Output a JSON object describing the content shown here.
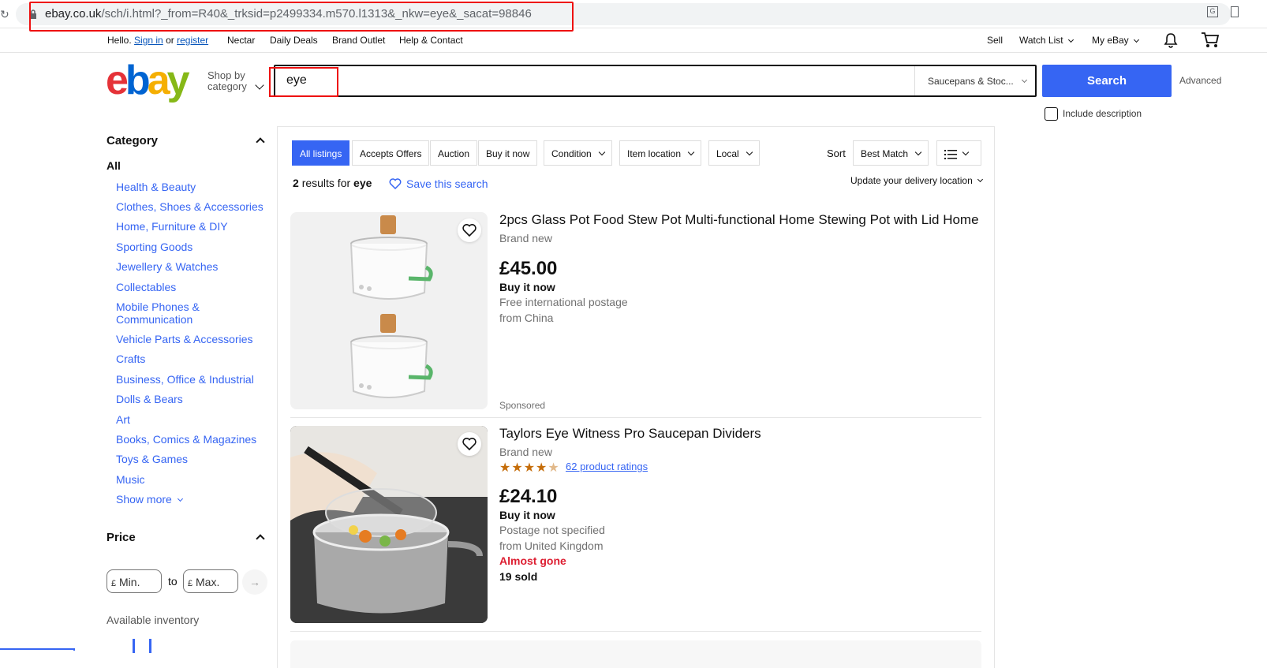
{
  "browser": {
    "url_domain": "ebay.co.uk",
    "url_path": "/sch/i.html?_from=R40&_trksid=p2499334.m570.l1313&_nkw=eye&_sacat=98846"
  },
  "topnav": {
    "hello": "Hello.",
    "sign_in": "Sign in",
    "or": "or",
    "register": "register",
    "links": [
      "Nectar",
      "Daily Deals",
      "Brand Outlet",
      "Help & Contact"
    ],
    "sell": "Sell",
    "watch_list": "Watch List",
    "my_ebay": "My eBay"
  },
  "header": {
    "logo_letters": [
      "e",
      "b",
      "a",
      "y"
    ],
    "shop_by_line1": "Shop by",
    "shop_by_line2": "category",
    "search_value": "eye",
    "category_select": "Saucepans & Stoc...",
    "search_button": "Search",
    "advanced": "Advanced",
    "include_description": "Include description"
  },
  "sidebar": {
    "category_heading": "Category",
    "all": "All",
    "categories": [
      "Health & Beauty",
      "Clothes, Shoes & Accessories",
      "Home, Furniture & DIY",
      "Sporting Goods",
      "Jewellery & Watches",
      "Collectables",
      "Mobile Phones &",
      "Communication",
      "Vehicle Parts & Accessories",
      "Crafts",
      "Business, Office & Industrial",
      "Dolls & Bears",
      "Art",
      "Books, Comics & Magazines",
      "Toys & Games",
      "Music"
    ],
    "show_more": "Show more",
    "price_heading": "Price",
    "currency": "£",
    "min_placeholder": "Min.",
    "to": "to",
    "max_placeholder": "Max.",
    "available_inventory": "Available inventory"
  },
  "results": {
    "chips": [
      "All listings",
      "Accepts Offers",
      "Auction",
      "Buy it now",
      "Condition",
      "Item location",
      "Local"
    ],
    "sort_label": "Sort",
    "sort_value": "Best Match",
    "count": "2",
    "results_for": "results for",
    "query": "eye",
    "save_search": "Save this search",
    "update_location": "Update your delivery location",
    "items": [
      {
        "title": "2pcs Glass Pot Food Stew Pot Multi-functional Home Stewing Pot with Lid Home",
        "condition": "Brand new",
        "price": "£45.00",
        "format": "Buy it now",
        "postage": "Free international postage",
        "location": "from China",
        "tag": "Sponsored"
      },
      {
        "title": "Taylors Eye Witness Pro Saucepan Dividers",
        "condition": "Brand new",
        "rating": 4.5,
        "ratings_text": "62 product ratings",
        "price": "£24.10",
        "format": "Buy it now",
        "postage": "Postage not specified",
        "location": "from United Kingdom",
        "urgency": "Almost gone",
        "sold": "19 sold"
      }
    ]
  },
  "colors": {
    "brand_blue": "#3665f3",
    "link_blue": "#0654ba",
    "logo_red": "#e53238",
    "logo_blue": "#0064d2",
    "logo_yellow": "#f5af02",
    "logo_green": "#86b817",
    "highlight_red": "#ee1111",
    "urgent_red": "#dd1e31",
    "star_gold": "#c56d0a"
  }
}
